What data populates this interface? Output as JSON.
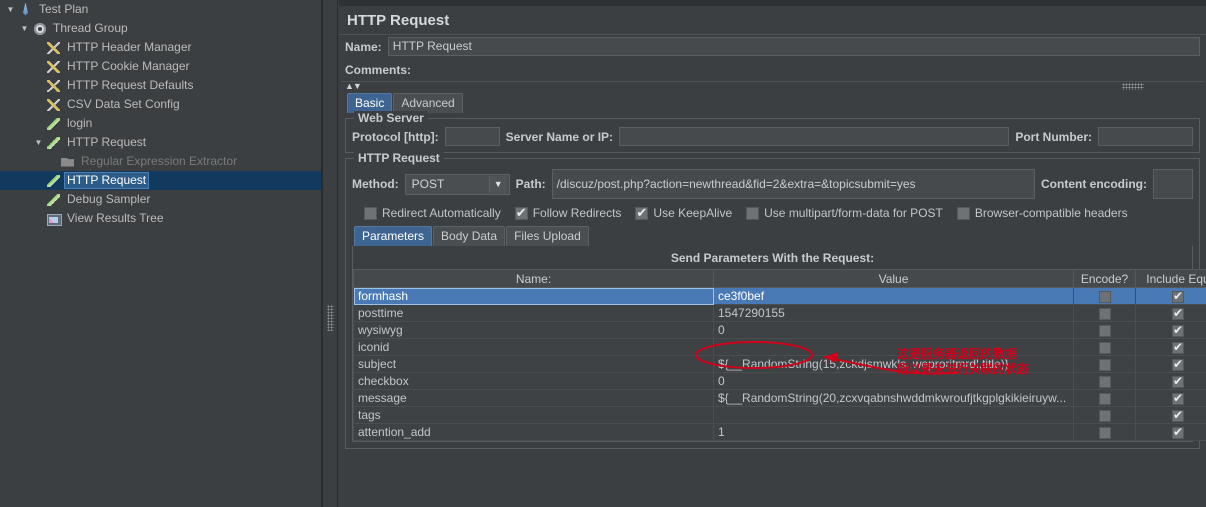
{
  "sidebar": {
    "items": [
      {
        "label": "Test Plan",
        "icon": "test-plan-icon",
        "indent": 0,
        "twist": "▼",
        "selected": false,
        "dim": false
      },
      {
        "label": "Thread Group",
        "icon": "gear-icon",
        "indent": 1,
        "twist": "▼",
        "selected": false,
        "dim": false
      },
      {
        "label": "HTTP Header Manager",
        "icon": "wrench-icon",
        "indent": 2,
        "twist": "",
        "selected": false,
        "dim": false
      },
      {
        "label": "HTTP Cookie Manager",
        "icon": "wrench-icon",
        "indent": 2,
        "twist": "",
        "selected": false,
        "dim": false
      },
      {
        "label": "HTTP Request Defaults",
        "icon": "wrench-icon",
        "indent": 2,
        "twist": "",
        "selected": false,
        "dim": false
      },
      {
        "label": "CSV Data Set Config",
        "icon": "wrench-icon",
        "indent": 2,
        "twist": "",
        "selected": false,
        "dim": false
      },
      {
        "label": "login",
        "icon": "pencil-icon",
        "indent": 2,
        "twist": "",
        "selected": false,
        "dim": false
      },
      {
        "label": "HTTP Request",
        "icon": "pencil-icon",
        "indent": 2,
        "twist": "▼",
        "selected": false,
        "dim": false
      },
      {
        "label": "Regular Expression Extractor",
        "icon": "folder-icon",
        "indent": 3,
        "twist": "",
        "selected": false,
        "dim": true
      },
      {
        "label": "HTTP Request",
        "icon": "pencil-icon",
        "indent": 2,
        "twist": "",
        "selected": true,
        "dim": false
      },
      {
        "label": "Debug Sampler",
        "icon": "pencil-icon",
        "indent": 2,
        "twist": "",
        "selected": false,
        "dim": false
      },
      {
        "label": "View Results Tree",
        "icon": "chart-icon",
        "indent": 2,
        "twist": "",
        "selected": false,
        "dim": false
      }
    ]
  },
  "panel": {
    "title": "HTTP Request",
    "name_label": "Name:",
    "name_value": "HTTP Request",
    "comments_label": "Comments:",
    "comments_value": "",
    "tabs": [
      {
        "label": "Basic",
        "active": true
      },
      {
        "label": "Advanced",
        "active": false
      }
    ]
  },
  "web_server": {
    "legend": "Web Server",
    "protocol_label": "Protocol [http]:",
    "protocol_value": "",
    "server_label": "Server Name or IP:",
    "server_value": "",
    "port_label": "Port Number:",
    "port_value": ""
  },
  "http_request": {
    "legend": "HTTP Request",
    "method_label": "Method:",
    "method_value": "POST",
    "method_caret": "▼",
    "path_label": "Path:",
    "path_value": "/discuz/post.php?action=newthread&fid=2&extra=&topicsubmit=yes",
    "content_encoding_label": "Content encoding:",
    "content_encoding_value": "",
    "checkboxes": [
      {
        "label": "Redirect Automatically",
        "checked": false
      },
      {
        "label": "Follow Redirects",
        "checked": true
      },
      {
        "label": "Use KeepAlive",
        "checked": true
      },
      {
        "label": "Use multipart/form-data for POST",
        "checked": false
      },
      {
        "label": "Browser-compatible headers",
        "checked": false
      }
    ]
  },
  "data_tabs": [
    {
      "label": "Parameters",
      "active": true
    },
    {
      "label": "Body Data",
      "active": false
    },
    {
      "label": "Files Upload",
      "active": false
    }
  ],
  "parameters": {
    "caption": "Send Parameters With the Request:",
    "columns": [
      "Name:",
      "Value",
      "Encode?",
      "Include Equ"
    ],
    "rows": [
      {
        "name": "formhash",
        "value": "ce3f0bef",
        "encode": false,
        "include": true,
        "selected": true
      },
      {
        "name": "posttime",
        "value": "1547290155",
        "encode": false,
        "include": true,
        "selected": false
      },
      {
        "name": "wysiwyg",
        "value": "0",
        "encode": false,
        "include": true,
        "selected": false
      },
      {
        "name": "iconid",
        "value": "",
        "encode": false,
        "include": true,
        "selected": false
      },
      {
        "name": "subject",
        "value": "${__RandomString(15,zckdjsmwkls.,weproritmrdl,title)}",
        "encode": false,
        "include": true,
        "selected": false
      },
      {
        "name": "checkbox",
        "value": "0",
        "encode": false,
        "include": true,
        "selected": false
      },
      {
        "name": "message",
        "value": "${__RandomString(20,zcxvqabnshwddmkwroufjtkgplgkikieiruyw...",
        "encode": false,
        "include": true,
        "selected": false
      },
      {
        "name": "tags",
        "value": "",
        "encode": false,
        "include": true,
        "selected": false
      },
      {
        "name": "attention_add",
        "value": "1",
        "encode": false,
        "include": true,
        "selected": false
      }
    ]
  },
  "annotation": {
    "color": "#d0021b",
    "line1": "这是服务器返回的数据",
    "line2": "所以是未进行关联的状态"
  }
}
